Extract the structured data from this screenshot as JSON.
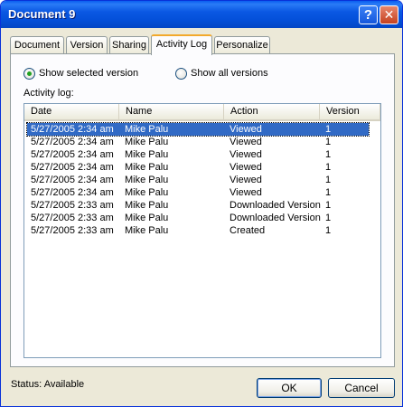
{
  "window": {
    "title": "Document 9",
    "help_label": "?",
    "close_label": "✕"
  },
  "tabs": [
    {
      "label": "Document",
      "active": false
    },
    {
      "label": "Version",
      "active": false
    },
    {
      "label": "Sharing",
      "active": false
    },
    {
      "label": "Activity Log",
      "active": true
    },
    {
      "label": "Personalize",
      "active": false
    }
  ],
  "options": {
    "show_selected": {
      "label": "Show selected version",
      "checked": true
    },
    "show_all": {
      "label": "Show all versions",
      "checked": false
    }
  },
  "activity_log_label": "Activity log:",
  "table": {
    "columns": [
      "Date",
      "Name",
      "Action",
      "Version"
    ],
    "rows": [
      {
        "date": "5/27/2005 2:34 am",
        "name": "Mike Palu",
        "action": "Viewed",
        "version": "1",
        "selected": true
      },
      {
        "date": "5/27/2005 2:34 am",
        "name": "Mike Palu",
        "action": "Viewed",
        "version": "1",
        "selected": false
      },
      {
        "date": "5/27/2005 2:34 am",
        "name": "Mike Palu",
        "action": "Viewed",
        "version": "1",
        "selected": false
      },
      {
        "date": "5/27/2005 2:34 am",
        "name": "Mike Palu",
        "action": "Viewed",
        "version": "1",
        "selected": false
      },
      {
        "date": "5/27/2005 2:34 am",
        "name": "Mike Palu",
        "action": "Viewed",
        "version": "1",
        "selected": false
      },
      {
        "date": "5/27/2005 2:34 am",
        "name": "Mike Palu",
        "action": "Viewed",
        "version": "1",
        "selected": false
      },
      {
        "date": "5/27/2005 2:33 am",
        "name": "Mike Palu",
        "action": "Downloaded Version",
        "version": "1",
        "selected": false
      },
      {
        "date": "5/27/2005 2:33 am",
        "name": "Mike Palu",
        "action": "Downloaded Version",
        "version": "1",
        "selected": false
      },
      {
        "date": "5/27/2005 2:33 am",
        "name": "Mike Palu",
        "action": "Created",
        "version": "1",
        "selected": false
      }
    ]
  },
  "status_text": "Status: Available",
  "buttons": {
    "ok": "OK",
    "cancel": "Cancel"
  },
  "colors": {
    "titlebar": "#0a58e3",
    "selection": "#316ac5",
    "active_tab_accent": "#f2a92c",
    "radio_dot": "#21a121"
  }
}
